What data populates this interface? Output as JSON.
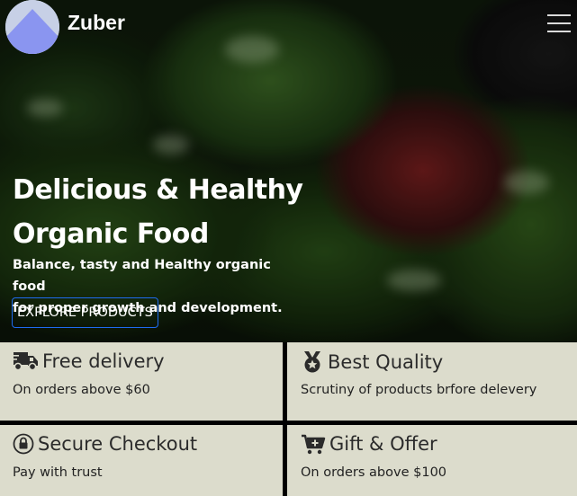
{
  "header": {
    "brand": "Zuber"
  },
  "hero": {
    "headline_line1": "Delicious & Healthy",
    "headline_line2": "Organic Food",
    "subtext_line1": "Balance, tasty and Healthy organic food",
    "subtext_line2": "for proper growth and development.",
    "cta_label": "EXPLORE PRODUCTS"
  },
  "features": [
    {
      "icon": "truck-icon",
      "title": "Free delivery",
      "desc": "On orders above $60"
    },
    {
      "icon": "medal-icon",
      "title": "Best Quality",
      "desc": "Scrutiny of products brfore delevery"
    },
    {
      "icon": "lock-icon",
      "title": "Secure Checkout",
      "desc": "Pay with trust"
    },
    {
      "icon": "cart-plus-icon",
      "title": "Gift & Offer",
      "desc": "On orders above $100"
    }
  ],
  "colors": {
    "card_background": "#dcdccc",
    "button_border": "#1e6cf0",
    "logo_accent": "#8a95f0"
  }
}
